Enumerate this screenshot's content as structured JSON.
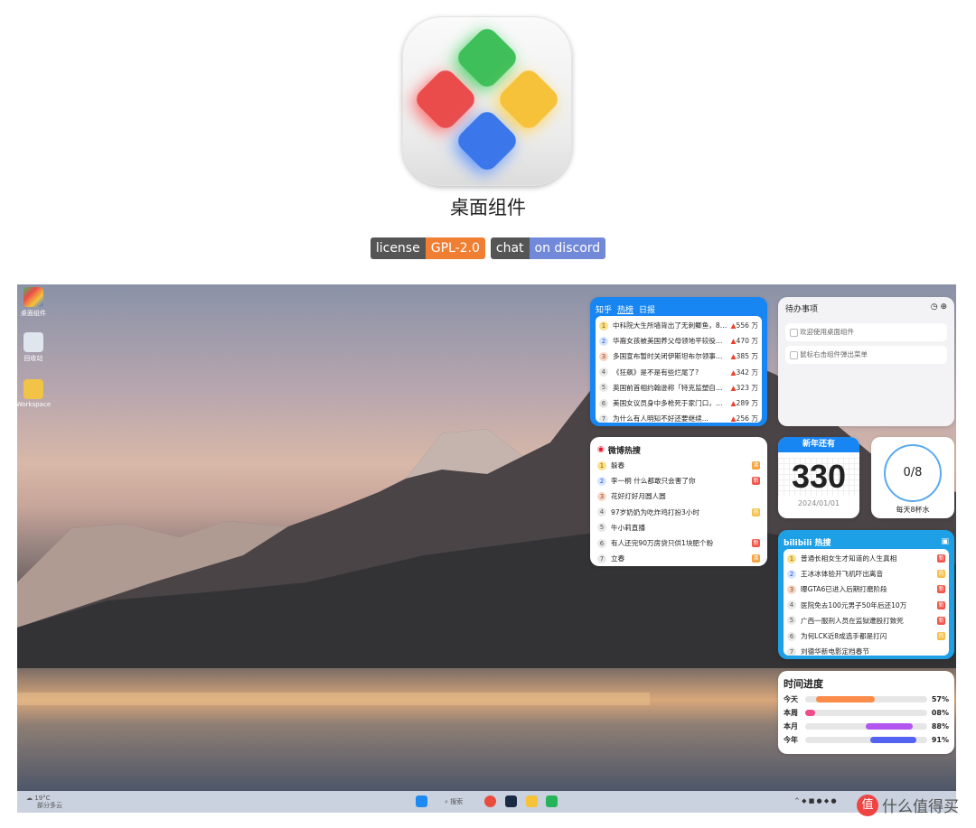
{
  "app": {
    "title": "桌面组件",
    "icon": "diamond-grid-app-icon"
  },
  "badges": [
    {
      "label": "license",
      "value": "GPL-2.0",
      "color": "#f07e33"
    },
    {
      "label": "chat",
      "value": "on discord",
      "color": "#7289da"
    }
  ],
  "desktop": {
    "icons": [
      {
        "label": "桌面组件"
      },
      {
        "label": "回收站"
      },
      {
        "label": "Workspace"
      }
    ]
  },
  "zhihu": {
    "brand": "知乎",
    "tabs": [
      "热榜",
      "日报"
    ],
    "items": [
      {
        "rank": "1",
        "title": "中科院大生所墙背出了无刺鲫鱼，80...",
        "heat": "556 万"
      },
      {
        "rank": "2",
        "title": "华裔女孩被美国养父母领地平较役十...",
        "heat": "470 万"
      },
      {
        "rank": "3",
        "title": "多国宣布暂时关闭伊斯坦布尔领事馆...",
        "heat": "385 万"
      },
      {
        "rank": "4",
        "title": "《狂飙》是不是有些烂尾了?",
        "heat": "342 万"
      },
      {
        "rank": "5",
        "title": "英国前首相约翰逊称「特克监塑自己...",
        "heat": "323 万"
      },
      {
        "rank": "6",
        "title": "美国女议员身中多枪死于家门口，警...",
        "heat": "289 万"
      },
      {
        "rank": "7",
        "title": "为什么有人明知不好还要继续...",
        "heat": "256 万"
      }
    ]
  },
  "todo": {
    "title": "待办事项",
    "items": [
      "欢迎使用桌面组件",
      "鼠标右击组件弹出菜单"
    ]
  },
  "weibo": {
    "title": "微博热搜",
    "items": [
      {
        "rank": "1",
        "title": "躲春",
        "tag": "沸"
      },
      {
        "rank": "2",
        "title": "李一桐 什么都敢只会害了你",
        "tag": "新"
      },
      {
        "rank": "3",
        "title": "花好灯好月圆人圆",
        "tag": ""
      },
      {
        "rank": "4",
        "title": "97岁奶奶为吃炸鸡打扮3小时",
        "tag": "热"
      },
      {
        "rank": "5",
        "title": "牛小莉直播",
        "tag": ""
      },
      {
        "rank": "6",
        "title": "有人还完90万房贷只供1块肥个粉",
        "tag": "新"
      },
      {
        "rank": "7",
        "title": "立春",
        "tag": "沸"
      }
    ]
  },
  "countdown": {
    "label": "新年还有",
    "days": "330",
    "date": "2024/01/01"
  },
  "water": {
    "value": "0/8",
    "label": "每天8杯水"
  },
  "bili": {
    "title": "热搜",
    "items": [
      {
        "rank": "1",
        "title": "普通长相女生才知道的人生真相",
        "tag": "新"
      },
      {
        "rank": "2",
        "title": "王冰冰体验开飞机吓出离音",
        "tag": "热"
      },
      {
        "rank": "3",
        "title": "曝GTA6已进入后期打磨阶段",
        "tag": "新"
      },
      {
        "rank": "4",
        "title": "医院免去100元男子50年后还10万",
        "tag": "新"
      },
      {
        "rank": "5",
        "title": "广西一服刑人员在监狱遭殴打致死",
        "tag": "新"
      },
      {
        "rank": "6",
        "title": "为何LCK近8成选手都是打闪",
        "tag": "热"
      },
      {
        "rank": "7",
        "title": "刘德华新电影定档春节",
        "tag": ""
      }
    ]
  },
  "progress": {
    "title": "时间进度",
    "rows": [
      {
        "label": "今天",
        "pct": "57%",
        "value": 0.57,
        "color": "#fb8c4a"
      },
      {
        "label": "本周",
        "pct": "08%",
        "value": 0.08,
        "color": "#f04c8c"
      },
      {
        "label": "本月",
        "pct": "88%",
        "value": 0.88,
        "color": "#b355ef"
      },
      {
        "label": "今年",
        "pct": "91%",
        "value": 0.91,
        "color": "#5462f2"
      }
    ]
  },
  "taskbar": {
    "weather": "19°C",
    "weather_sub": "部分多云",
    "search": "搜索"
  },
  "watermark": {
    "icon": "值",
    "text": "什么值得买"
  }
}
